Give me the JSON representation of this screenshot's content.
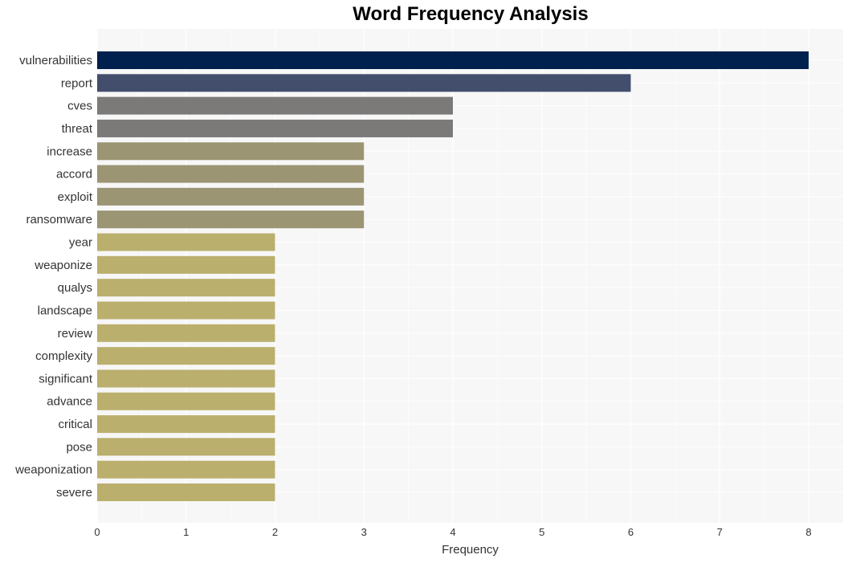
{
  "chart_data": {
    "type": "bar",
    "orientation": "horizontal",
    "title": "Word Frequency Analysis",
    "xlabel": "Frequency",
    "ylabel": "",
    "xlim": [
      0,
      8.4
    ],
    "xticks": [
      0,
      1,
      2,
      3,
      4,
      5,
      6,
      7,
      8
    ],
    "grid": true,
    "legend": "none",
    "categories": [
      "vulnerabilities",
      "report",
      "cves",
      "threat",
      "increase",
      "accord",
      "exploit",
      "ransomware",
      "year",
      "weaponize",
      "qualys",
      "landscape",
      "review",
      "complexity",
      "significant",
      "advance",
      "critical",
      "pose",
      "weaponization",
      "severe"
    ],
    "values": [
      8,
      6,
      4,
      4,
      3,
      3,
      3,
      3,
      2,
      2,
      2,
      2,
      2,
      2,
      2,
      2,
      2,
      2,
      2,
      2
    ],
    "colors": [
      "#00204e",
      "#434e6c",
      "#7c7a78",
      "#7c7a78",
      "#9b9574",
      "#9b9574",
      "#9b9574",
      "#9b9574",
      "#bbaf6e",
      "#bbaf6e",
      "#bbaf6e",
      "#bbaf6e",
      "#bbaf6e",
      "#bbaf6e",
      "#bbaf6e",
      "#bbaf6e",
      "#bbaf6e",
      "#bbaf6e",
      "#bbaf6e",
      "#bbaf6e"
    ],
    "plot_background": "#f7f7f7",
    "grid_color": "#ffffff"
  }
}
